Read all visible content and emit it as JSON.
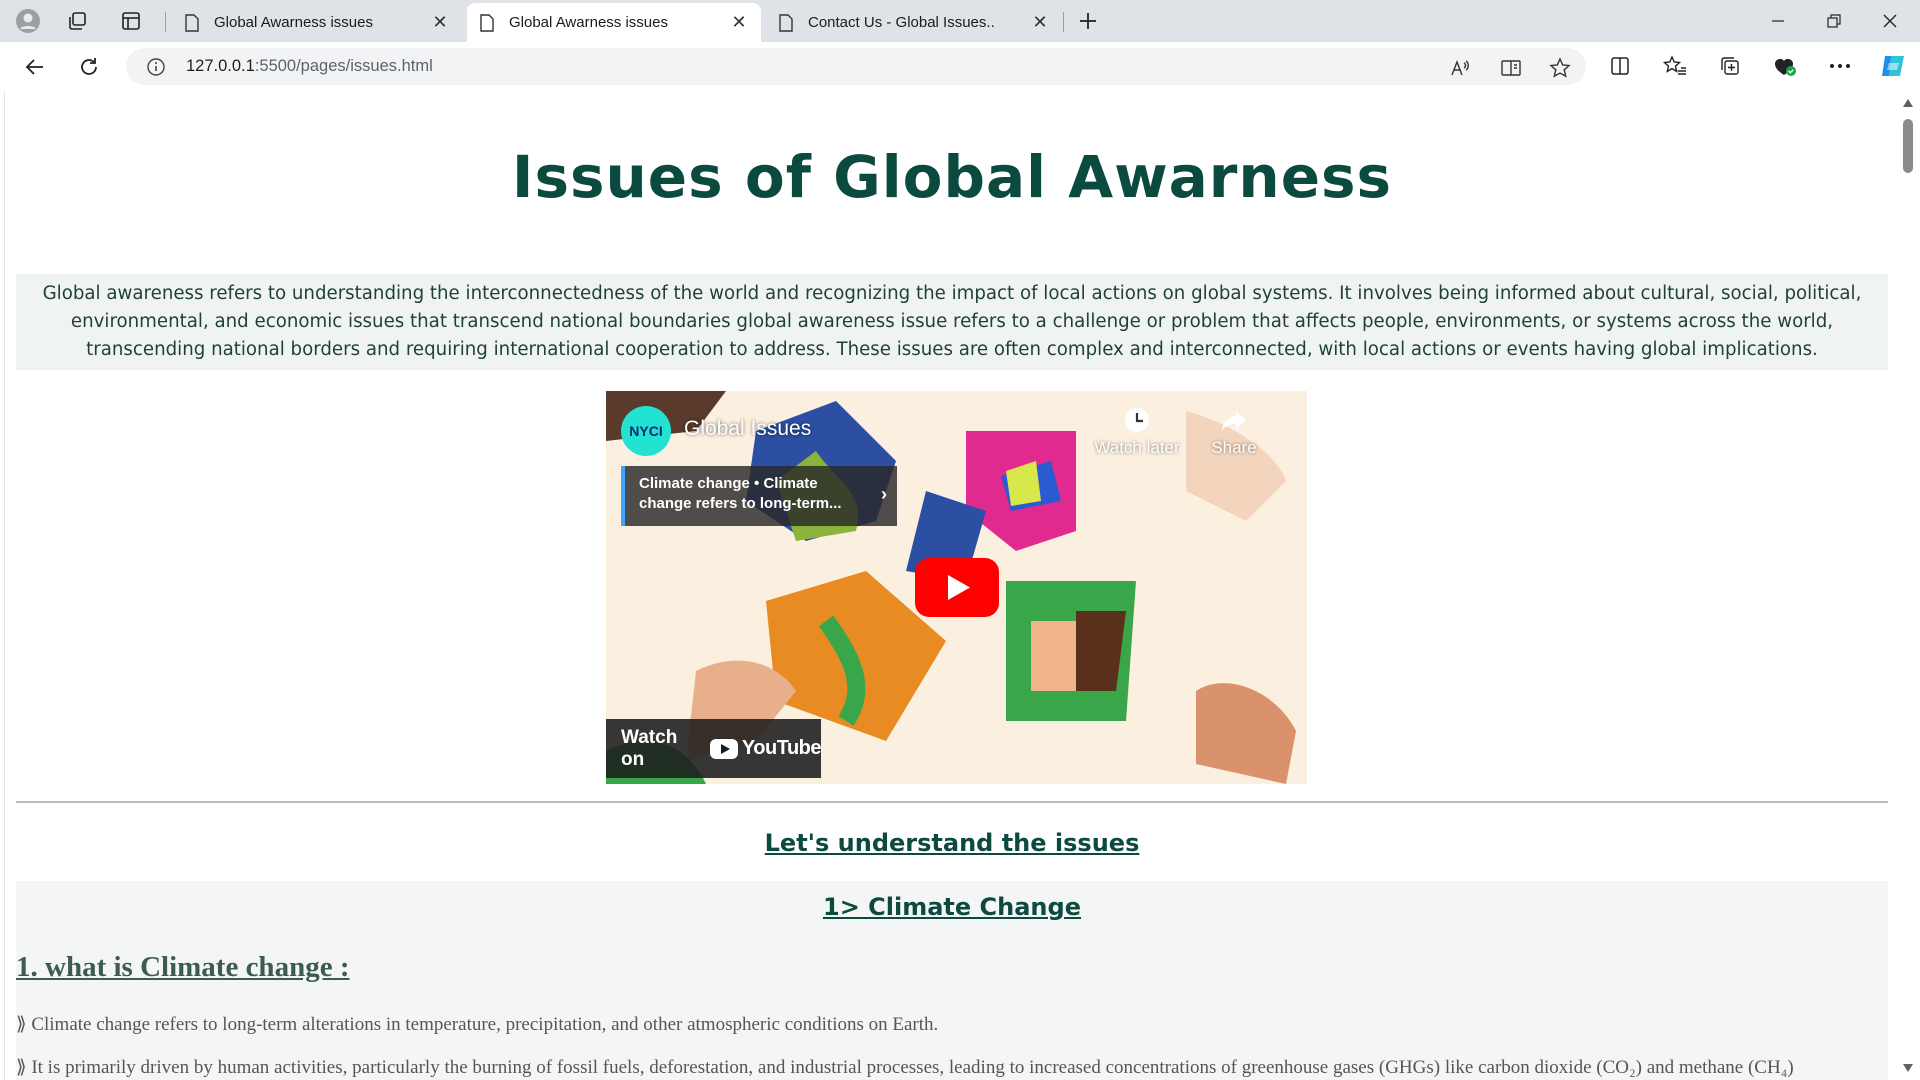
{
  "browser": {
    "tabs": [
      {
        "label": "Global Awarness issues",
        "active": false
      },
      {
        "label": "Global Awarness issues",
        "active": true
      },
      {
        "label": "Contact Us - Global Issues..",
        "active": false
      }
    ],
    "url": {
      "host": "127.0.0.1",
      "path": ":5500/pages/issues.html"
    },
    "icons": [
      "profile-icon",
      "workspaces-icon",
      "tab-actions-icon",
      "new-tab-icon",
      "back-icon",
      "refresh-icon",
      "info-icon",
      "read-aloud-icon",
      "immersive-reader-icon",
      "favorite-star-icon",
      "split-screen-icon",
      "favorites-icon",
      "collections-icon",
      "browser-essentials-icon",
      "more-icon",
      "copilot-icon"
    ]
  },
  "page": {
    "title": "Issues of Global Awarness",
    "intro": "Global awareness refers to understanding the interconnectedness of the world and recognizing the impact of local actions on global systems. It involves being informed about cultural, social, political, environmental, and economic issues that transcend national boundaries global awareness issue refers to a challenge or problem that affects people, environments, or systems across the world, transcending national borders and requiring international cooperation to address. These issues are often complex and interconnected, with local actions or events having global implications.",
    "video": {
      "channel_avatar": "NYCI",
      "title": "Global Issues",
      "card_line1": "Climate change • Climate",
      "card_line2": "change refers to long-term...",
      "watch_later": "Watch later",
      "share": "Share",
      "watch_on": "Watch on",
      "youtube": "YouTube"
    },
    "section_heading": "Let's understand the issues",
    "topic_title": "1> Climate Change",
    "sub_heading": "1. what is Climate change :",
    "paragraphs": [
      "⟫ Climate change refers to long-term alterations in temperature, precipitation, and other atmospheric conditions on Earth.",
      "⟫ It is primarily driven by human activities, particularly the burning of fossil fuels, deforestation, and industrial processes, leading to increased concentrations of greenhouse gases (GHGs) like carbon dioxide (CO₂) and methane (CH₄)"
    ]
  },
  "colors": {
    "heading": "#0b4a3f",
    "intro_bg": "#eff4f3",
    "tabbar_bg": "#dfe3e8",
    "youtube_red": "#ff0000"
  }
}
